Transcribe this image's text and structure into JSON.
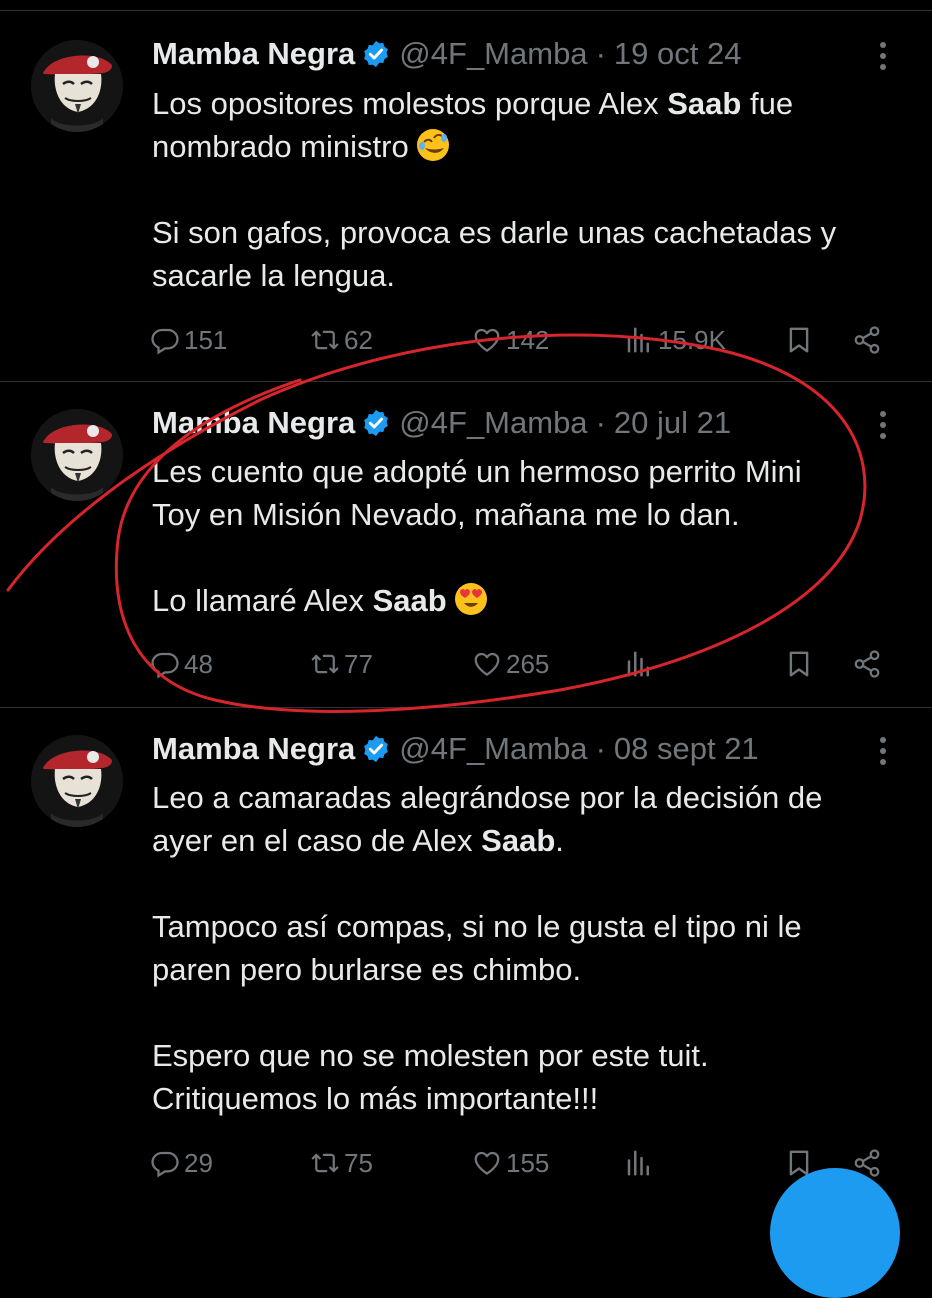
{
  "tweets": [
    {
      "name": "Mamba Negra",
      "handle": "@4F_Mamba",
      "separator": "·",
      "date": "19 oct 24",
      "l1a": "Los opositores molestos porque Alex ",
      "l1b": "Saab",
      "l1c": " fue",
      "l2": "nombrado ministro",
      "l3": "Si son gafos, provoca es darle unas cachetadas y",
      "l4": "sacarle la lengua.",
      "replies": "151",
      "retweets": "62",
      "likes": "142",
      "views": "15.9K"
    },
    {
      "name": "Mamba Negra",
      "handle": "@4F_Mamba",
      "separator": "·",
      "date": "20 jul 21",
      "l1": "Les cuento que adopté un hermoso perrito Mini",
      "l2": "Toy en Misión Nevado, mañana me lo dan.",
      "l3a": "Lo llamaré Alex ",
      "l3b": "Saab",
      "replies": "48",
      "retweets": "77",
      "likes": "265"
    },
    {
      "name": "Mamba Negra",
      "handle": "@4F_Mamba",
      "separator": "·",
      "date": "08 sept 21",
      "l1": "Leo a camaradas alegrándose por la decisión de",
      "l2a": "ayer en el caso de Alex ",
      "l2b": "Saab",
      "l2c": ".",
      "l3": "Tampoco así compas, si no le gusta el tipo ni le",
      "l4": "paren pero burlarse es chimbo.",
      "l5": "Espero que no se molesten por este tuit.",
      "l6": "Critiquemos lo más importante!!!",
      "replies": "29",
      "retweets": "75",
      "likes": "155"
    }
  ],
  "colors": {
    "background": "#000000",
    "text": "#e7e9ea",
    "muted": "#71767b",
    "verified": "#1d9bf0",
    "annotation": "#d6252b"
  },
  "icons": [
    "reply-icon",
    "retweet-icon",
    "like-icon",
    "views-icon",
    "bookmark-icon",
    "share-icon",
    "verified-icon",
    "more-icon"
  ]
}
